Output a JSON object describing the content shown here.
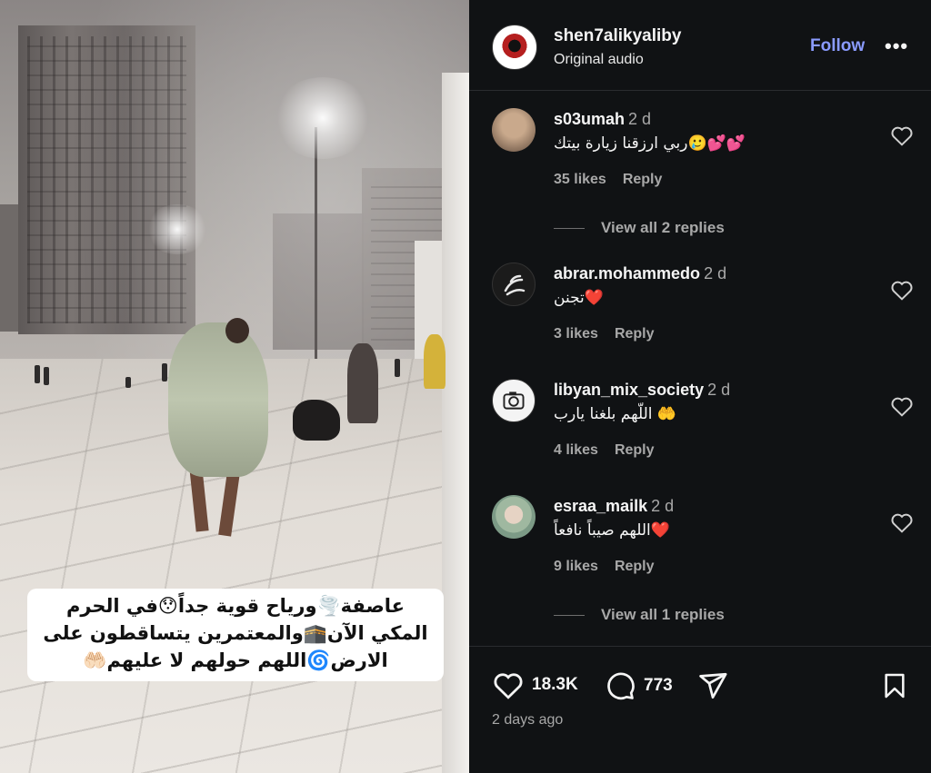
{
  "video": {
    "caption_lines": [
      "عاصفة🌪️ورياح قوية جداً😯في الحرم",
      "المكي الآن🕋والمعتمرين يتساقطون على",
      "الارض🌀اللهم حولهم لا عليهم🤲🏻"
    ]
  },
  "post": {
    "username": "shen7alikyaliby",
    "audio": "Original audio",
    "follow_label": "Follow",
    "more_label": "•••"
  },
  "comments": [
    {
      "username": "s03umah",
      "time": "2 d",
      "text": "ربي ارزقنا زيارة بيتك🥲💕💕",
      "likes": "35 likes",
      "reply": "Reply",
      "view_replies": "View all 2 replies"
    },
    {
      "username": "abrar.mohammedo",
      "time": "2 d",
      "text": "تجنن❤️",
      "likes": "3 likes",
      "reply": "Reply"
    },
    {
      "username": "libyan_mix_society",
      "time": "2 d",
      "text": "اللّهم بلغنا يارب 🤲",
      "likes": "4 likes",
      "reply": "Reply"
    },
    {
      "username": "esraa_mailk",
      "time": "2 d",
      "text": "اللهم صيباً نافعاً❤️",
      "likes": "9 likes",
      "reply": "Reply",
      "view_replies": "View all 1 replies"
    }
  ],
  "footer": {
    "likes_count": "18.3K",
    "comments_count": "773",
    "time_ago": "2 days ago"
  }
}
